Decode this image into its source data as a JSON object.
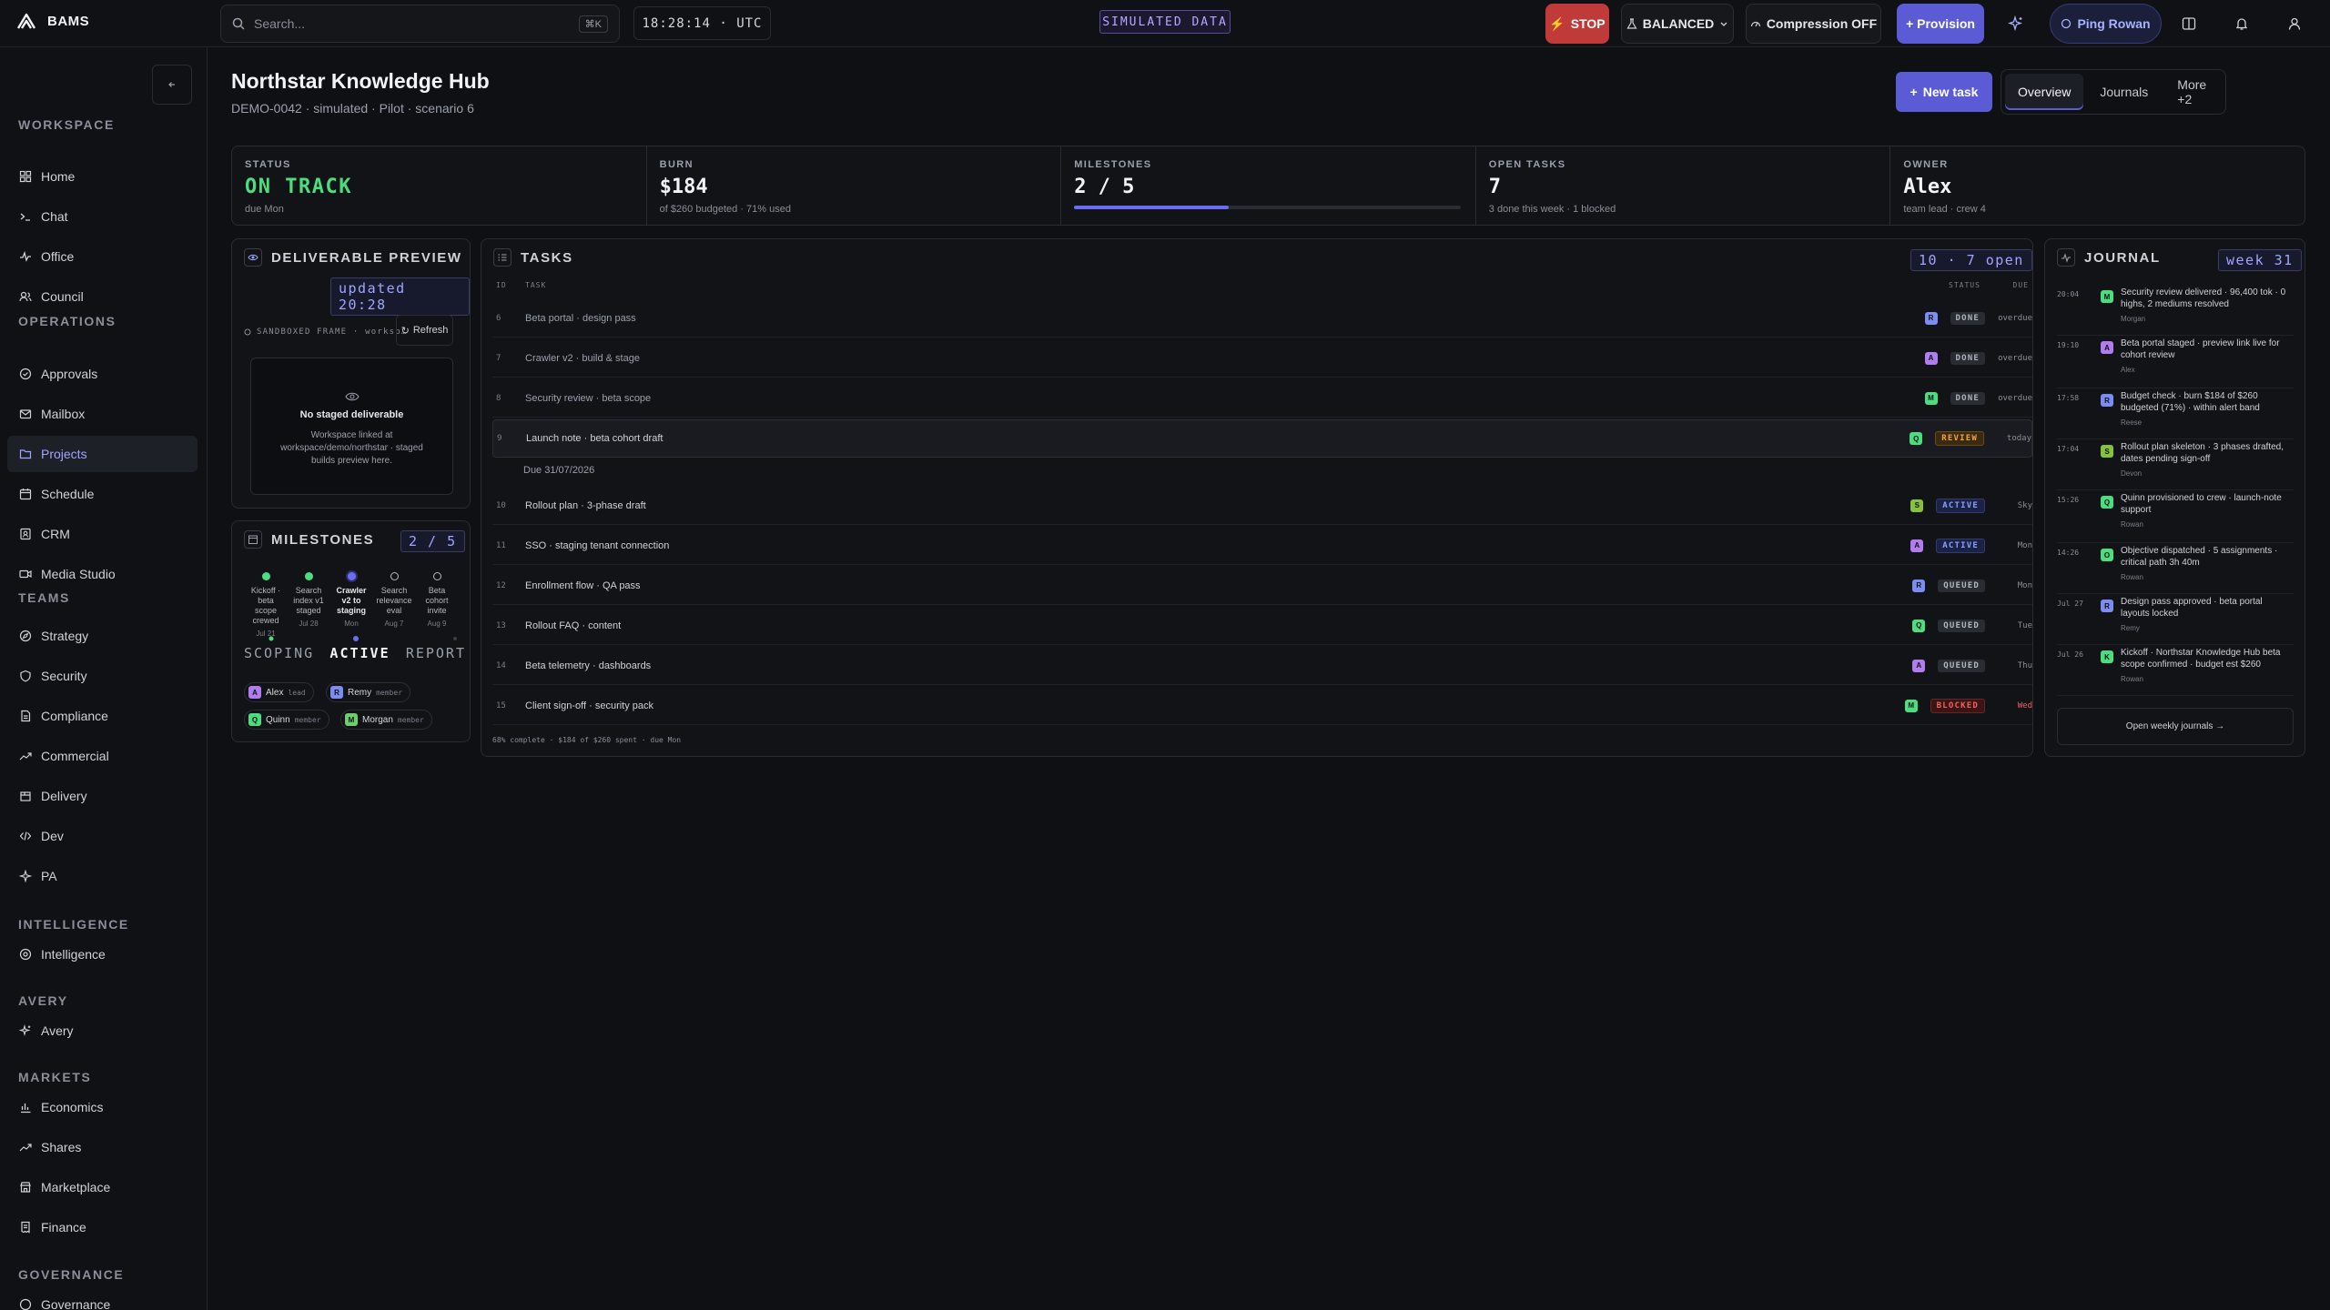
{
  "brand": {
    "name": "BAMS"
  },
  "search": {
    "placeholder": "Search...",
    "shortcut": "⌘K"
  },
  "clock": "18:28:14 · UTC",
  "sim_tag": "SIMULATED DATA",
  "topbar": {
    "stop": "STOP",
    "balanced": "BALANCED",
    "compression": "Compression OFF",
    "provision": "+ Provision",
    "ping": "Ping Rowan"
  },
  "sidebar": {
    "sections": {
      "workspace": "WORKSPACE",
      "operations": "OPERATIONS",
      "teams": "TEAMS",
      "intelligence": "INTELLIGENCE",
      "avery": "AVERY",
      "markets": "MARKETS",
      "governance": "GOVERNANCE"
    },
    "items": {
      "home": "Home",
      "chat": "Chat",
      "office": "Office",
      "council": "Council",
      "approvals": "Approvals",
      "mailbox": "Mailbox",
      "projects": "Projects",
      "schedule": "Schedule",
      "crm": "CRM",
      "media": "Media Studio",
      "strategy": "Strategy",
      "security": "Security",
      "compliance": "Compliance",
      "commercial": "Commercial",
      "delivery": "Delivery",
      "dev": "Dev",
      "pa": "PA",
      "intelligence": "Intelligence",
      "avery": "Avery",
      "economics": "Economics",
      "shares": "Shares",
      "marketplace": "Marketplace",
      "finance": "Finance",
      "governance": "Governance"
    }
  },
  "page": {
    "title": "Northstar Knowledge Hub",
    "subtitle": "DEMO-0042 · simulated · Pilot · scenario 6",
    "new_task": "New task"
  },
  "tabs": [
    "Overview",
    "Journals",
    "More +2"
  ],
  "stats": {
    "status": {
      "label": "STATUS",
      "value": "ON TRACK",
      "sub": "due Mon"
    },
    "burn": {
      "label": "BURN",
      "value": "$184",
      "sub": "of $260 budgeted · 71% used"
    },
    "milestones": {
      "label": "MILESTONES",
      "value": "2 / 5",
      "progress": 0.4
    },
    "open_tasks": {
      "label": "OPEN TASKS",
      "value": "7",
      "sub": "3 done this week · 1 blocked"
    },
    "owner": {
      "label": "OWNER",
      "value": "Alex",
      "sub": "team lead · crew 4"
    }
  },
  "preview": {
    "title": "DELIVERABLE PREVIEW",
    "updated": "updated 20:28",
    "frame_label": "SANDBOXED FRAME · worksp…",
    "refresh": "Refresh",
    "empty_title": "No staged deliverable",
    "empty_body": "Workspace linked at workspace/demo/northstar · staged builds preview here."
  },
  "milestones": {
    "title": "MILESTONES",
    "count": "2 / 5",
    "items": [
      {
        "name": "Kickoff · beta scope crewed",
        "date": "Jul 21"
      },
      {
        "name": "Search index v1 staged",
        "date": "Jul 28"
      },
      {
        "name": "Crawler v2 to staging",
        "date": "Mon"
      },
      {
        "name": "Search relevance eval",
        "date": "Aug 7"
      },
      {
        "name": "Beta cohort invite",
        "date": "Aug 9"
      }
    ],
    "phases": [
      "SCOPING",
      "ACTIVE",
      "REPORT"
    ],
    "crew": [
      {
        "initial": "A",
        "name": "Alex",
        "role": "lead"
      },
      {
        "initial": "R",
        "name": "Remy",
        "role": "member"
      },
      {
        "initial": "Q",
        "name": "Quinn",
        "role": "member"
      },
      {
        "initial": "M",
        "name": "Morgan",
        "role": "member"
      }
    ]
  },
  "tasks": {
    "title": "TASKS",
    "count": "10 · 7 open",
    "col_num": "ID",
    "col_task": "TASK",
    "col_status": "STATUS",
    "col_due": "DUE",
    "due_note": "Due 31/07/2026",
    "footer": "68% complete · $184 of $260 spent · due Mon",
    "rows": [
      {
        "id": "6",
        "name": "Beta portal · design pass",
        "av": "R",
        "status": "DONE",
        "due": "overdue"
      },
      {
        "id": "7",
        "name": "Crawler v2 · build & stage",
        "av": "A",
        "status": "DONE",
        "due": "overdue"
      },
      {
        "id": "8",
        "name": "Security review · beta scope",
        "av": "M",
        "status": "DONE",
        "due": "overdue"
      },
      {
        "id": "9",
        "name": "Launch note · beta cohort draft",
        "av": "Q",
        "status": "REVIEW",
        "due": "today"
      },
      {
        "id": "10",
        "name": "Rollout plan · 3-phase draft",
        "av": "S",
        "status": "ACTIVE",
        "due": "Sky"
      },
      {
        "id": "11",
        "name": "SSO · staging tenant connection",
        "av": "A",
        "status": "ACTIVE",
        "due": "Mon"
      },
      {
        "id": "12",
        "name": "Enrollment flow · QA pass",
        "av": "R",
        "status": "QUEUED",
        "due": "Mon"
      },
      {
        "id": "13",
        "name": "Rollout FAQ · content",
        "av": "Q",
        "status": "QUEUED",
        "due": "Tue"
      },
      {
        "id": "14",
        "name": "Beta telemetry · dashboards",
        "av": "A",
        "status": "QUEUED",
        "due": "Thu"
      },
      {
        "id": "15",
        "name": "Client sign-off · security pack",
        "av": "M",
        "status": "BLOCKED",
        "due": "Wed"
      }
    ]
  },
  "journal": {
    "title": "JOURNAL",
    "week": "week 31",
    "button": "Open weekly journals →",
    "entries": [
      {
        "time": "20:04",
        "av": "M",
        "text": "Security review delivered · 96,400 tok · 0 highs, 2 mediums resolved",
        "who": "Morgan"
      },
      {
        "time": "19:10",
        "av": "A",
        "text": "Beta portal staged · preview link live for cohort review",
        "who": "Alex"
      },
      {
        "time": "17:58",
        "av": "R",
        "text": "Budget check · burn $184 of $260 budgeted (71%) · within alert band",
        "who": "Reese"
      },
      {
        "time": "17:04",
        "av": "S",
        "text": "Rollout plan skeleton · 3 phases drafted, dates pending sign-off",
        "who": "Devon"
      },
      {
        "time": "15:26",
        "av": "Q",
        "text": "Quinn provisioned to crew · launch-note support",
        "who": "Rowan"
      },
      {
        "time": "14:26",
        "av": "O",
        "text": "Objective dispatched · 5 assignments · critical path 3h 40m",
        "who": "Rowan"
      },
      {
        "time": "Jul 27",
        "av": "R",
        "text": "Design pass approved · beta portal layouts locked",
        "who": "Remy"
      },
      {
        "time": "Jul 26",
        "av": "K",
        "text": "Kickoff · Northstar Knowledge Hub beta scope confirmed · budget est $260",
        "who": "Rowan"
      }
    ]
  }
}
